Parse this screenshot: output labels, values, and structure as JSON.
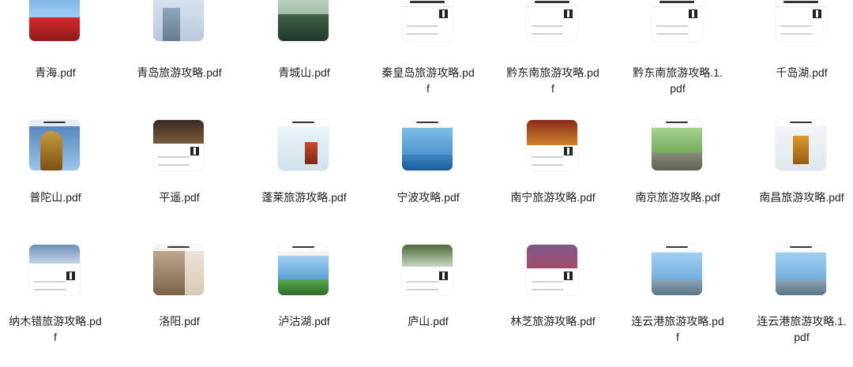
{
  "files": [
    {
      "name": "青海.pdf",
      "palette": "p-red",
      "icon": "pdf-thumbnail-icon"
    },
    {
      "name": "青岛旅游攻略.pdf",
      "palette": "p-city",
      "icon": "pdf-thumbnail-icon"
    },
    {
      "name": "青城山.pdf",
      "palette": "p-green",
      "icon": "pdf-thumbnail-icon"
    },
    {
      "name": "秦皇岛旅游攻略.pdf",
      "palette": "p-doc",
      "icon": "pdf-thumbnail-icon"
    },
    {
      "name": "黔东南旅游攻略.pdf",
      "palette": "p-doc",
      "icon": "pdf-thumbnail-icon"
    },
    {
      "name": "黔东南旅游攻略.1.pdf",
      "palette": "p-doc",
      "icon": "pdf-thumbnail-icon"
    },
    {
      "name": "千岛湖.pdf",
      "palette": "p-doc",
      "icon": "pdf-thumbnail-icon"
    },
    {
      "name": "普陀山.pdf",
      "palette": "p-buddha",
      "icon": "pdf-thumbnail-icon"
    },
    {
      "name": "平遥.pdf",
      "palette": "p-street",
      "icon": "pdf-thumbnail-icon"
    },
    {
      "name": "蓬莱旅游攻略.pdf",
      "palette": "p-pagoda",
      "icon": "pdf-thumbnail-icon"
    },
    {
      "name": "宁波攻略.pdf",
      "palette": "p-lake",
      "icon": "pdf-thumbnail-icon"
    },
    {
      "name": "南宁旅游攻略.pdf",
      "palette": "p-nanning",
      "icon": "pdf-thumbnail-icon"
    },
    {
      "name": "南京旅游攻略.pdf",
      "palette": "p-trees",
      "icon": "pdf-thumbnail-icon"
    },
    {
      "name": "南昌旅游攻略.pdf",
      "palette": "p-tower",
      "icon": "pdf-thumbnail-icon"
    },
    {
      "name": "纳木错旅游攻略.pdf",
      "palette": "p-namtso",
      "icon": "pdf-thumbnail-icon"
    },
    {
      "name": "洛阳.pdf",
      "palette": "p-cliff",
      "icon": "pdf-thumbnail-icon"
    },
    {
      "name": "泸沽湖.pdf",
      "palette": "p-water",
      "icon": "pdf-thumbnail-icon"
    },
    {
      "name": "庐山.pdf",
      "palette": "p-falls",
      "icon": "pdf-thumbnail-icon"
    },
    {
      "name": "林芝旅游攻略.pdf",
      "palette": "p-flowers",
      "icon": "pdf-thumbnail-icon"
    },
    {
      "name": "连云港旅游攻略.pdf",
      "palette": "p-sea",
      "icon": "pdf-thumbnail-icon"
    },
    {
      "name": "连云港旅游攻略.1.pdf",
      "palette": "p-sea",
      "icon": "pdf-thumbnail-icon"
    }
  ]
}
